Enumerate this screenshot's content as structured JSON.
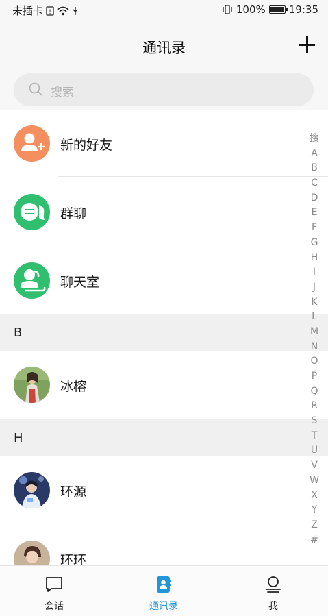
{
  "status_bar": {
    "carrier": "未插卡",
    "battery": "100%",
    "time": "19:35"
  },
  "header": {
    "title": "通讯录"
  },
  "search": {
    "placeholder": "搜索"
  },
  "features": [
    {
      "label": "新的好友",
      "icon": "add-friend-icon",
      "color": "#f58f5f"
    },
    {
      "label": "群聊",
      "icon": "group-chat-icon",
      "color": "#2fbf6e"
    },
    {
      "label": "聊天室",
      "icon": "chatroom-icon",
      "color": "#2fbf6e"
    }
  ],
  "sections": [
    {
      "letter": "B",
      "contacts": [
        {
          "name": "冰榕"
        }
      ]
    },
    {
      "letter": "H",
      "contacts": [
        {
          "name": "环源"
        },
        {
          "name": "环环"
        }
      ]
    }
  ],
  "index_bar": [
    "搜",
    "A",
    "B",
    "C",
    "D",
    "E",
    "F",
    "G",
    "H",
    "I",
    "J",
    "K",
    "L",
    "M",
    "N",
    "O",
    "P",
    "Q",
    "R",
    "S",
    "T",
    "U",
    "V",
    "W",
    "X",
    "Y",
    "Z",
    "#"
  ],
  "tabs": [
    {
      "label": "会话",
      "icon": "chat-bubble-icon",
      "active": false
    },
    {
      "label": "通讯录",
      "icon": "contacts-book-icon",
      "active": true
    },
    {
      "label": "我",
      "icon": "profile-icon",
      "active": false
    }
  ],
  "colors": {
    "accent": "#2196d8",
    "orange": "#f58f5f",
    "green": "#2fbf6e"
  }
}
